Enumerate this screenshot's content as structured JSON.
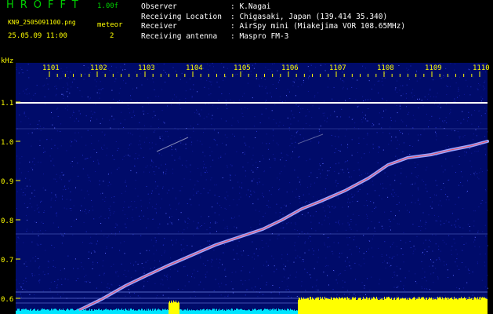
{
  "header": {
    "app_title": "HROFFT",
    "version": "1.00f",
    "filename": "KN9_2505091100.png",
    "mode": "meteor",
    "datetime": "25.05.09 11:00",
    "count": "2"
  },
  "info": [
    {
      "label": "Observer",
      "value": "K.Nagai"
    },
    {
      "label": "Receiving Location",
      "value": "Chigasaki, Japan (139.414 35.340)"
    },
    {
      "label": "Receiver",
      "value": "AirSpy mini (Miakejima VOR 108.65MHz)"
    },
    {
      "label": "Receiving antenna",
      "value": "Maspro FM-3"
    }
  ],
  "spectrogram": {
    "y_unit": "kHz",
    "time_ticks": [
      "1101",
      "1102",
      "1103",
      "1104",
      "1105",
      "1106",
      "1107",
      "1108",
      "1109",
      "1110"
    ],
    "freq_ticks": [
      "1.1",
      "1.0",
      "0.9",
      "0.8",
      "0.7",
      "0.6"
    ],
    "colors": {
      "background": "#000b6a",
      "tick": "#ffff00",
      "carrier": "#ffffff",
      "noise_bar_low": "#00e5ff",
      "noise_bar_high": "#ffff00"
    }
  }
}
